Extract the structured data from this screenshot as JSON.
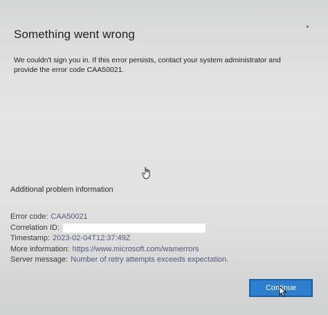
{
  "dialog": {
    "title": "Something went wrong",
    "message": "We couldn't sign you in. If this error persists, contact your system administrator and provide the error code CAA50021."
  },
  "details": {
    "section_title": "Additional problem information",
    "error_code_label": "Error code:",
    "error_code": "CAA50021",
    "correlation_id_label": "Correlation ID:",
    "timestamp_label": "Timestamp:",
    "timestamp": "2023-02-04T12:37:49Z",
    "more_info_label": "More information:",
    "more_info": "https://www.microsoft.com/wamerrors",
    "server_message_label": "Server message:",
    "server_message": "Number of retry attempts exceeds expectation."
  },
  "buttons": {
    "continue_label": "Continue"
  },
  "colors": {
    "accent": "#2d7fce",
    "background": "#dcdedd"
  }
}
